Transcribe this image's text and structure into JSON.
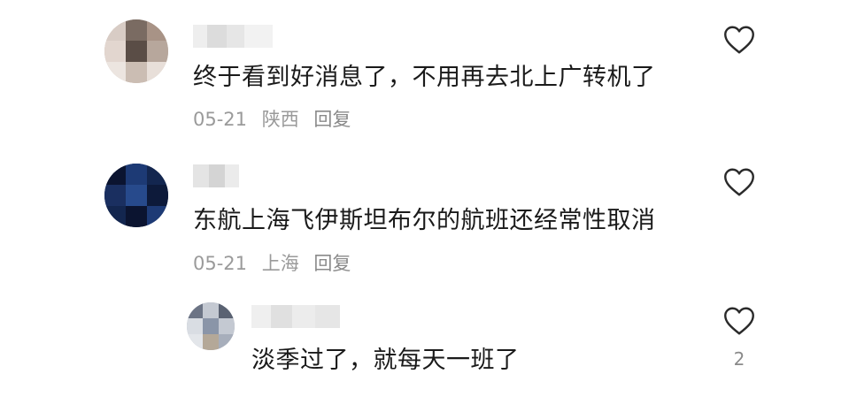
{
  "comments": [
    {
      "text": "终于看到好消息了，不用再去北上广转机了",
      "date": "05-21",
      "location": "陕西",
      "reply_label": "回复",
      "avatar_colors": [
        "#c9b9ae",
        "#a89386",
        "#7a6b62",
        "#e2d6cf",
        "#5a4d46",
        "#b7a79c"
      ]
    },
    {
      "text": "东航上海飞伊斯坦布尔的航班还经常性取消",
      "date": "05-21",
      "location": "上海",
      "reply_label": "回复",
      "avatar_colors": [
        "#13264f",
        "#1d3a75",
        "#0d1a3a",
        "#274a8c",
        "#1a2f60",
        "#0b1430"
      ]
    }
  ],
  "reply": {
    "text": "淡季过了，就每天一班了",
    "like_count": "2",
    "avatar_colors": [
      "#8a95a8",
      "#c4c9d2",
      "#5a6272",
      "#a7aebb",
      "#6c7485",
      "#d9dde3"
    ]
  },
  "icons": {
    "like": "heart-outline-icon"
  }
}
